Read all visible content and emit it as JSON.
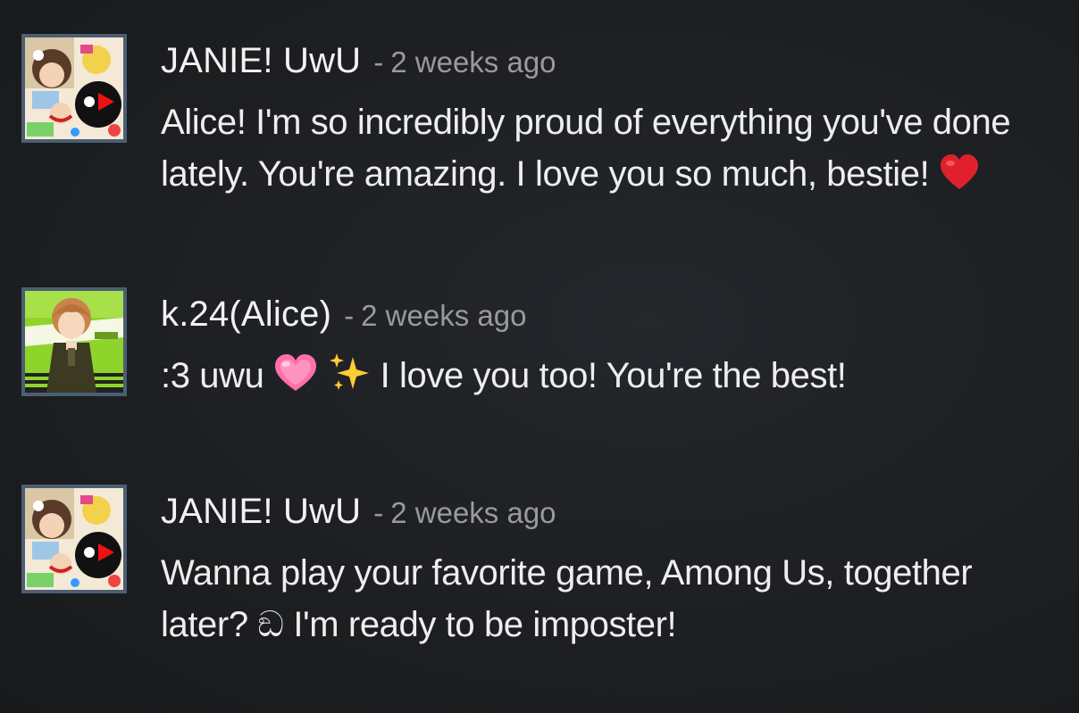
{
  "comments": [
    {
      "author": "JANIE! UwU",
      "separator": "-",
      "time": "2 weeks ago",
      "text_before": "Alice! I'm so incredibly proud of everything you've done lately. You're amazing. I love you so much, bestie! ",
      "emoji": "red-heart"
    },
    {
      "author": "k.24(Alice)",
      "separator": "-",
      "time": "2 weeks ago",
      "text_before": ":3 uwu ",
      "emoji_1": "pink-heart",
      "emoji_2": "sparkles",
      "text_after": " I love you too! You're the best!"
    },
    {
      "author": "JANIE! UwU",
      "separator": "-",
      "time": "2 weeks ago",
      "text_line": "Wanna play your favorite game, Among Us, together later? ඞ I'm ready to be imposter!"
    }
  ],
  "avatar_border_color": "#4b5e73",
  "heart_red": "#e0202c",
  "heart_pink": "#ff6fa8",
  "sparkle_yellow": "#ffcc33"
}
